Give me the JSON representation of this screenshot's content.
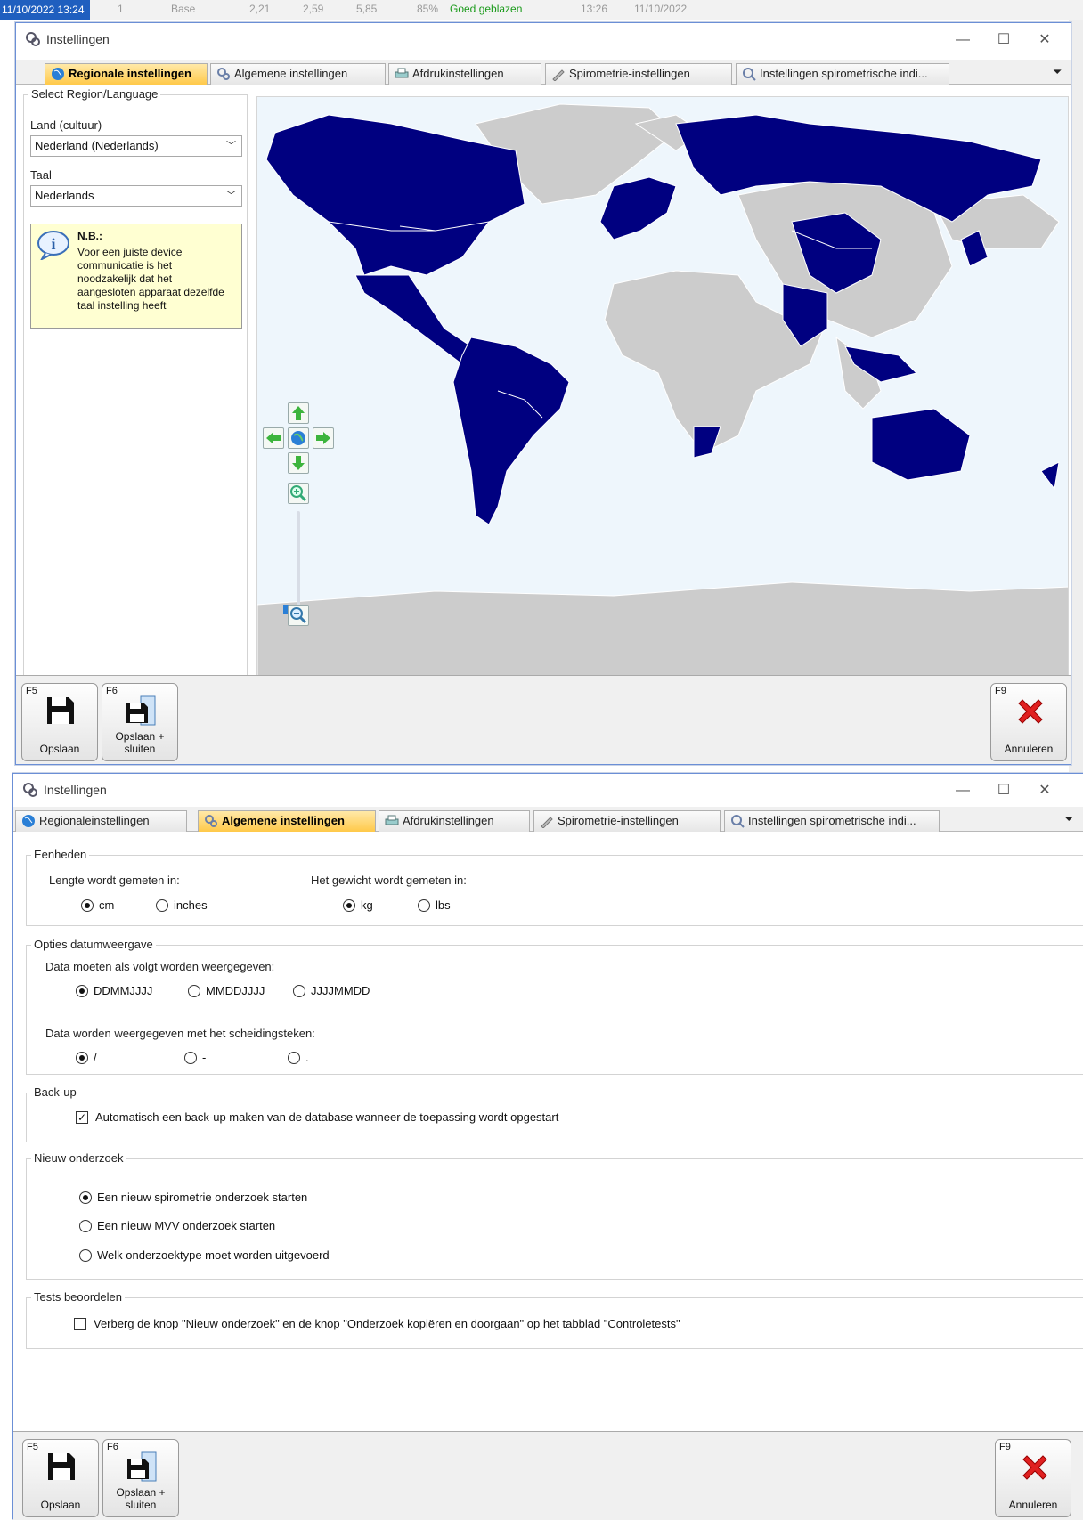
{
  "background": {
    "timestamp": "11/10/2022 13:24",
    "row_cells": [
      "1",
      "Base",
      "2,21",
      "2,59",
      "5,85",
      "85%",
      "Goed geblazen",
      "13:26",
      "11/10/2022"
    ]
  },
  "window1": {
    "title": "Instellingen",
    "tabs": [
      {
        "label": "Regionale instellingen",
        "icon": "globe-icon",
        "active": true
      },
      {
        "label": "Algemene instellingen",
        "icon": "settings-icon",
        "active": false
      },
      {
        "label": "Afdrukinstellingen",
        "icon": "printer-icon",
        "active": false
      },
      {
        "label": "Spirometrie-instellingen",
        "icon": "spirometer-icon",
        "active": false
      },
      {
        "label": "Instellingen spirometrische indi...",
        "icon": "indication-icon",
        "active": false
      }
    ],
    "region_panel": {
      "legend": "Select Region/Language",
      "country_label": "Land (cultuur)",
      "country_value": "Nederland (Nederlands)",
      "language_label": "Taal",
      "language_value": "Nederlands",
      "note_title": "N.B.:",
      "note_text": "Voor een juiste device communicatie is het noodzakelijk dat het aangesloten apparaat dezelfde taal instelling heeft"
    },
    "map": {
      "highlight_color": "#000080",
      "land_color": "#cccccc",
      "sea_color": "#eef6fc",
      "zoom_level": 0.08
    }
  },
  "window2": {
    "title": "Instellingen",
    "tabs": [
      {
        "label": "Regionaleinstellingen",
        "icon": "globe-icon",
        "active": false
      },
      {
        "label": "Algemene instellingen",
        "icon": "settings-icon",
        "active": true
      },
      {
        "label": "Afdrukinstellingen",
        "icon": "printer-icon",
        "active": false
      },
      {
        "label": "Spirometrie-instellingen",
        "icon": "spirometer-icon",
        "active": false
      },
      {
        "label": "Instellingen spirometrische indi...",
        "icon": "indication-icon",
        "active": false
      }
    ],
    "units": {
      "legend": "Eenheden",
      "length_label": "Lengte wordt gemeten in:",
      "length_options": [
        "cm",
        "inches"
      ],
      "length_selected": "cm",
      "weight_label": "Het gewicht wordt gemeten in:",
      "weight_options": [
        "kg",
        "lbs"
      ],
      "weight_selected": "kg"
    },
    "date": {
      "legend": "Opties datumweergave",
      "format_label": "Data moeten als volgt worden weergegeven:",
      "format_options": [
        "DDMMJJJJ",
        "MMDDJJJJ",
        "JJJJMMDD"
      ],
      "format_selected": "DDMMJJJJ",
      "separator_label": "Data worden weergegeven met het scheidingsteken:",
      "separator_options": [
        "/",
        "-",
        "."
      ],
      "separator_selected": "/"
    },
    "backup": {
      "legend": "Back-up",
      "checkbox_label": "Automatisch een back-up maken van de database wanneer de toepassing wordt opgestart",
      "checked": true
    },
    "new_exam": {
      "legend": "Nieuw onderzoek",
      "options": [
        "Een nieuw spirometrie onderzoek starten",
        "Een nieuw MVV onderzoek starten",
        "Welk onderzoektype moet worden uitgevoerd"
      ],
      "selected": "Een nieuw spirometrie onderzoek starten"
    },
    "tests": {
      "legend": "Tests beoordelen",
      "checkbox_label": "Verberg de knop \"Nieuw onderzoek\" en de knop \"Onderzoek kopiëren en doorgaan\" op het tabblad \"Controletests\"",
      "checked": false
    }
  },
  "footer": {
    "save_key": "F5",
    "save_label": "Opslaan",
    "save_close_key": "F6",
    "save_close_label_1": "Opslaan +",
    "save_close_label_2": "sluiten",
    "cancel_key": "F9",
    "cancel_label": "Annuleren"
  },
  "colors": {
    "active_tab": "#ffc94a",
    "cancel": "#e02020",
    "accent": "#1f5fbf"
  }
}
